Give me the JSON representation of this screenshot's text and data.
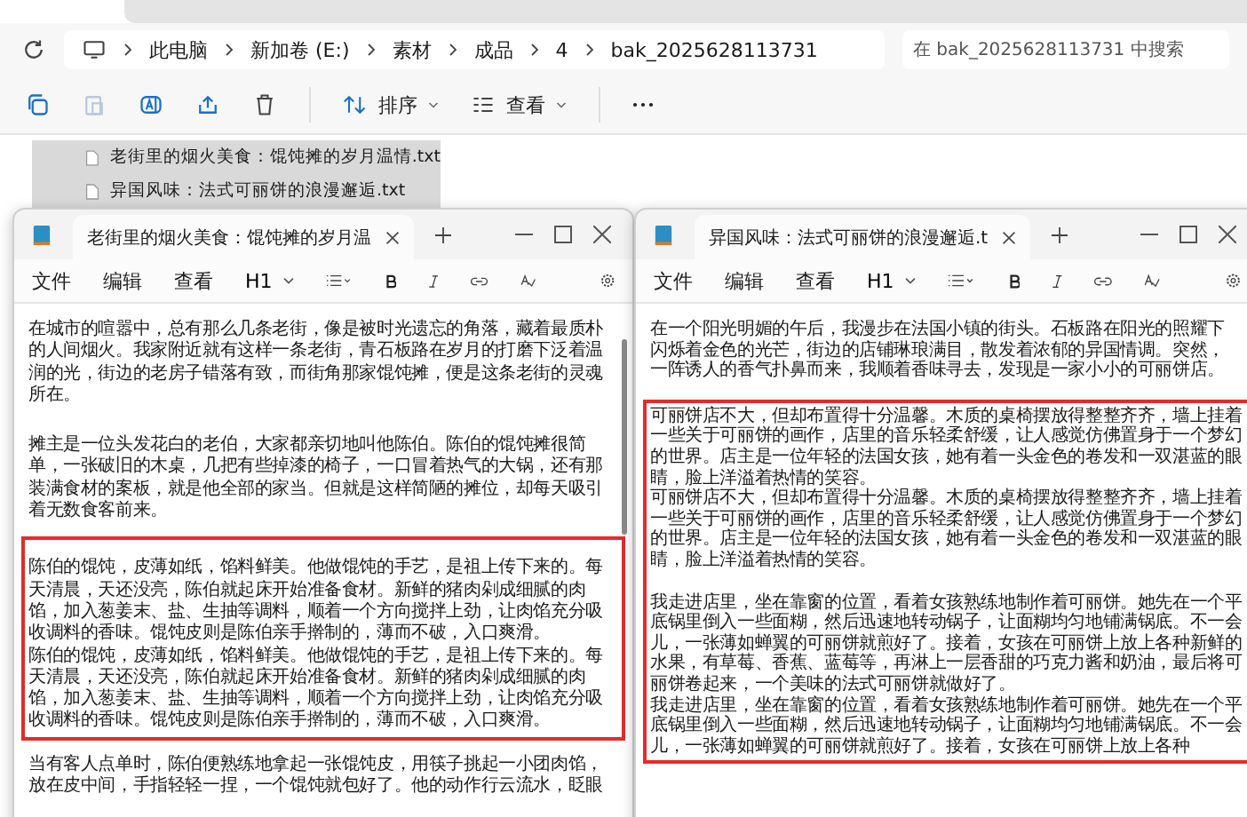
{
  "explorer": {
    "breadcrumb": [
      "此电脑",
      "新加卷 (E:)",
      "素材",
      "成品",
      "4",
      "bak_2025628113731"
    ],
    "search": {
      "placeholder": "在 bak_2025628113731 中搜索"
    },
    "toolbar": {
      "sort": "排序",
      "view": "查看"
    },
    "files": [
      {
        "name": "老街里的烟火美食：馄饨摊的岁月温情.txt",
        "selected": true
      },
      {
        "name": "异国风味：法式可丽饼的浪漫邂逅.txt",
        "selected": true
      }
    ]
  },
  "windows": [
    {
      "tab_title": "老街里的烟火美食：馄饨摊的岁月温",
      "menu": [
        "文件",
        "编辑",
        "查看"
      ],
      "heading": "H1",
      "blocks": [
        {
          "highlighted": false,
          "groups": [
            [
              "在城市的喧嚣中，总有那么几条老街，像是被时光遗忘的角落，藏着最质朴的人间烟火。我家附近就有这样一条老街，青石板路在岁月的打磨下泛着温润的光，街边的老房子错落有致，而街角那家馄饨摊，便是这条老街的灵魂所在。"
            ],
            [
              "摊主是一位头发花白的老伯，大家都亲切地叫他陈伯。陈伯的馄饨摊很简单，一张破旧的木桌，几把有些掉漆的椅子，一口冒着热气的大锅，还有那装满食材的案板，就是他全部的家当。但就是这样简陋的摊位，却每天吸引着无数食客前来。"
            ]
          ]
        },
        {
          "highlighted": true,
          "groups": [
            [
              "陈伯的馄饨，皮薄如纸，馅料鲜美。他做馄饨的手艺，是祖上传下来的。每天清晨，天还没亮，陈伯就起床开始准备食材。新鲜的猪肉剁成细腻的肉馅，加入葱姜末、盐、生抽等调料，顺着一个方向搅拌上劲，让肉馅充分吸收调料的香味。馄饨皮则是陈伯亲手擀制的，薄而不破，入口爽滑。",
              "陈伯的馄饨，皮薄如纸，馅料鲜美。他做馄饨的手艺，是祖上传下来的。每天清晨，天还没亮，陈伯就起床开始准备食材。新鲜的猪肉剁成细腻的肉馅，加入葱姜末、盐、生抽等调料，顺着一个方向搅拌上劲，让肉馅充分吸收调料的香味。馄饨皮则是陈伯亲手擀制的，薄而不破，入口爽滑。"
            ]
          ]
        },
        {
          "highlighted": false,
          "groups": [
            [
              "当有客人点单时，陈伯便熟练地拿起一张馄饨皮，用筷子挑起一小团肉馅，放在皮中间，手指轻轻一捏，一个馄饨就包好了。他的动作行云流水，眨眼"
            ]
          ]
        }
      ]
    },
    {
      "tab_title": "异国风味：法式可丽饼的浪漫邂逅.t",
      "menu": [
        "文件",
        "编辑",
        "查看"
      ],
      "heading": "H1",
      "blocks": [
        {
          "highlighted": false,
          "groups": [
            [
              "在一个阳光明媚的午后，我漫步在法国小镇的街头。石板路在阳光的照耀下闪烁着金色的光芒，街边的店铺琳琅满目，散发着浓郁的异国情调。突然，一阵诱人的香气扑鼻而来，我顺着香味寻去，发现是一家小小的可丽饼店。"
            ]
          ]
        },
        {
          "highlighted": true,
          "groups": [
            [
              "可丽饼店不大，但却布置得十分温馨。木质的桌椅摆放得整整齐齐，墙上挂着一些关于可丽饼的画作，店里的音乐轻柔舒缓，让人感觉仿佛置身于一个梦幻的世界。店主是一位年轻的法国女孩，她有着一头金色的卷发和一双湛蓝的眼睛，脸上洋溢着热情的笑容。",
              "可丽饼店不大，但却布置得十分温馨。木质的桌椅摆放得整整齐齐，墙上挂着一些关于可丽饼的画作，店里的音乐轻柔舒缓，让人感觉仿佛置身于一个梦幻的世界。店主是一位年轻的法国女孩，她有着一头金色的卷发和一双湛蓝的眼睛，脸上洋溢着热情的笑容。"
            ],
            [
              "我走进店里，坐在靠窗的位置，看着女孩熟练地制作着可丽饼。她先在一个平底锅里倒入一些面糊，然后迅速地转动锅子，让面糊均匀地铺满锅底。不一会儿，一张薄如蝉翼的可丽饼就煎好了。接着，女孩在可丽饼上放上各种新鲜的水果，有草莓、香蕉、蓝莓等，再淋上一层香甜的巧克力酱和奶油，最后将可丽饼卷起来，一个美味的法式可丽饼就做好了。",
              "我走进店里，坐在靠窗的位置，看着女孩熟练地制作着可丽饼。她先在一个平底锅里倒入一些面糊，然后迅速地转动锅子，让面糊均匀地铺满锅底。不一会儿，一张薄如蝉翼的可丽饼就煎好了。接着，女孩在可丽饼上放上各种"
            ]
          ]
        }
      ]
    }
  ]
}
